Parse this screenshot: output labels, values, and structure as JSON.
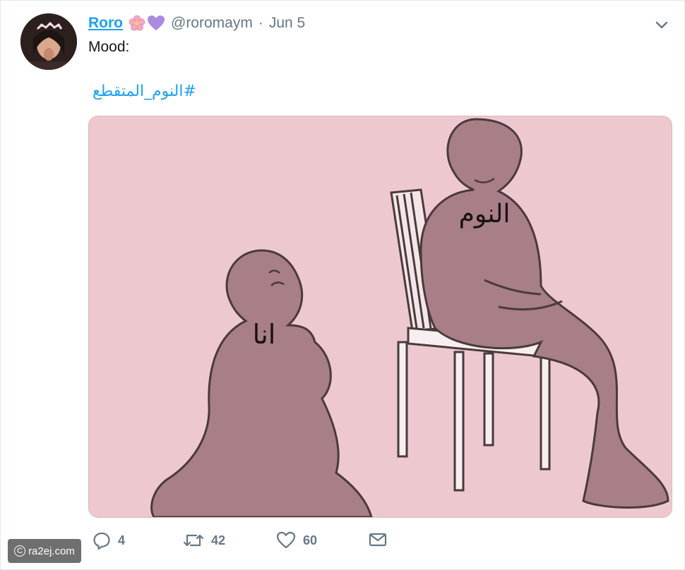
{
  "tweet": {
    "display_name": "Roro",
    "handle": "@roromaym",
    "separator": "·",
    "date": "Jun 5",
    "text": "Mood:",
    "hashtag": "#النوم_المتقطع"
  },
  "image": {
    "label_sleep": "النوم",
    "label_me": "انا"
  },
  "actions": {
    "replies": "4",
    "retweets": "42",
    "likes": "60"
  },
  "watermark": {
    "symbol": "C",
    "text": "ra2ej.com"
  },
  "colors": {
    "link": "#1da1f2",
    "muted": "#657786",
    "image_bg": "#eec8cf",
    "figure": "#a87f86"
  }
}
